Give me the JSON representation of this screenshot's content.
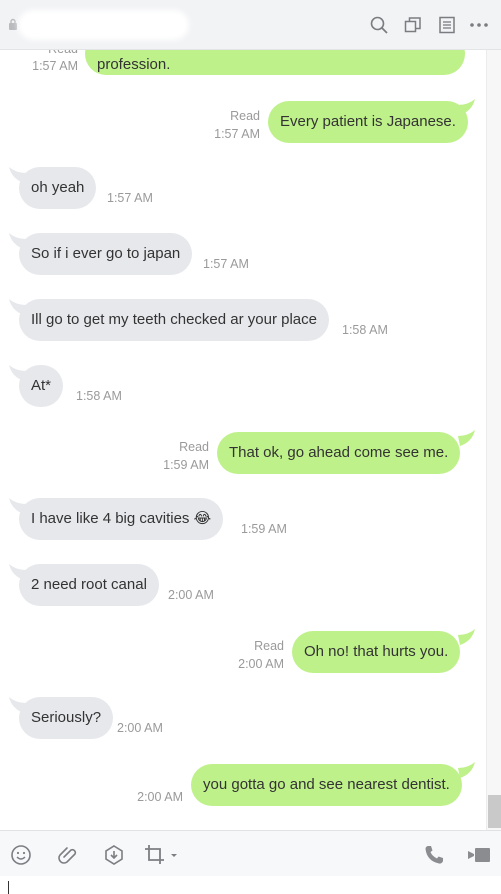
{
  "header": {
    "lock_icon": "lock-icon",
    "icons": [
      "search-icon",
      "copy-icon",
      "notes-icon",
      "more-icon"
    ]
  },
  "messages": [
    {
      "side": "out",
      "text": "profession.",
      "status": "Read",
      "time": "1:57 AM"
    },
    {
      "side": "out",
      "text": "Every patient is Japanese.",
      "status": "Read",
      "time": "1:57 AM"
    },
    {
      "side": "in",
      "text": "oh yeah",
      "time": "1:57 AM"
    },
    {
      "side": "in",
      "text": "So if i ever go to japan",
      "time": "1:57 AM"
    },
    {
      "side": "in",
      "text": "Ill go to get my teeth checked ar your place",
      "time": "1:58 AM"
    },
    {
      "side": "in",
      "text": "At*",
      "time": "1:58 AM"
    },
    {
      "side": "out",
      "text": "That ok, go ahead come see me.",
      "status": "Read",
      "time": "1:59 AM"
    },
    {
      "side": "in",
      "text": "I have like 4 big cavities 😂",
      "time": "1:59 AM"
    },
    {
      "side": "in",
      "text": "2 need root canal",
      "time": "2:00 AM"
    },
    {
      "side": "out",
      "text": "Oh no! that hurts you.",
      "status": "Read",
      "time": "2:00 AM"
    },
    {
      "side": "in",
      "text": "Seriously?",
      "time": "2:00 AM"
    },
    {
      "side": "out",
      "text": "you gotta go and see nearest dentist.",
      "time": "2:00 AM"
    }
  ],
  "toolbar": {
    "icons": [
      "emoji-icon",
      "attach-icon",
      "download-icon",
      "crop-icon",
      "phone-icon",
      "video-icon"
    ]
  },
  "colors": {
    "outgoing_bubble": "#bff18b",
    "incoming_bubble": "#e6e8ec",
    "meta_text": "#9a9a9a"
  }
}
